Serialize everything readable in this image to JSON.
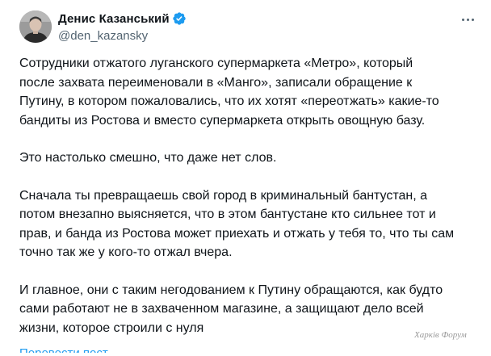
{
  "author": {
    "display_name": "Денис Казанський",
    "handle": "@den_kazansky",
    "verified_color": "#1d9bf0"
  },
  "menu": {
    "icon": "more-horizontal-icon"
  },
  "post": {
    "paragraphs": [
      {
        "lines": [
          "Сотрудники отжатого луганского супермаркета «Метро», который",
          "после захвата переименовали в «Манго», записали обращение к",
          "Путину, в котором пожаловались, что их хотят «переотжать» какие-то",
          "бандиты из Ростова и вместо супермаркета открыть овощную базу."
        ]
      },
      {
        "lines": [
          "Это настолько смешно, что даже нет слов."
        ]
      },
      {
        "lines": [
          "Сначала ты превращаешь свой город в криминальный бантустан, а",
          "потом внезапно выясняется, что в этом бантустане кто сильнее тот и",
          "прав, и банда из Ростова может приехать и отжать у тебя то, что ты сам",
          "точно так же у кого-то отжал вчера."
        ]
      },
      {
        "lines": [
          "И главное, они с таким негодованием к Путину обращаются, как будто",
          "сами работают не в захваченном магазине, а защищают дело всей",
          "жизни, которое строили с нуля"
        ]
      }
    ]
  },
  "translate_link": "Перевести пост",
  "watermark": "Харків Форум"
}
